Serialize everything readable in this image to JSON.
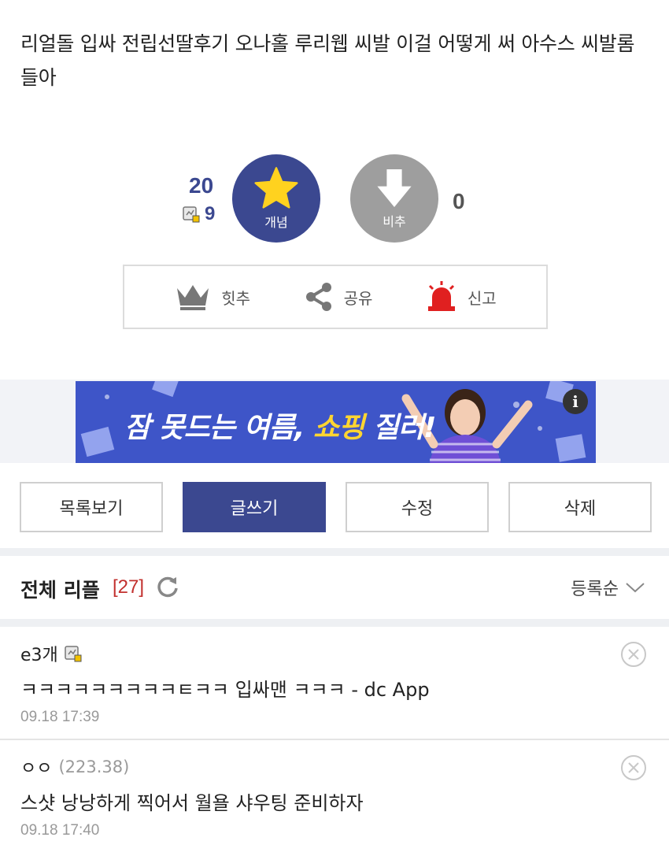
{
  "post": {
    "body": "리얼돌 입싸 전립선딸후기 오나홀 루리웹 씨발 이걸 어떻게 써 아수스 씨발롬들아"
  },
  "vote": {
    "up_count": "20",
    "fix_count": "9",
    "up_label": "개념",
    "down_label": "비추",
    "down_count": "0",
    "accent": "#3b4890",
    "down_color": "#9e9e9e"
  },
  "actions": {
    "hit": "힛추",
    "share": "공유",
    "report": "신고"
  },
  "ad": {
    "text_a": "잠 못드는 여름, ",
    "text_b": "쇼핑",
    "text_c": " 질러!",
    "info": "i",
    "bg": "#3e55c8"
  },
  "buttons": {
    "list": "목록보기",
    "write": "글쓰기",
    "edit": "수정",
    "delete": "삭제"
  },
  "comments": {
    "title": "전체 리플",
    "count": "[27]",
    "sort": "등록순",
    "items": [
      {
        "nick": "e3개",
        "ip": "",
        "text": "ㅋㅋㅋㅋㅋㅋㅋㅋㅋㅌㅋㅋ 입싸맨 ㅋㅋㅋ - dc App",
        "time": "09.18 17:39"
      },
      {
        "nick": "ㅇㅇ",
        "ip": "(223.38)",
        "text": "스샷 낭낭하게 찍어서 월욜 샤우팅 준비하자",
        "time": "09.18 17:40"
      }
    ]
  }
}
